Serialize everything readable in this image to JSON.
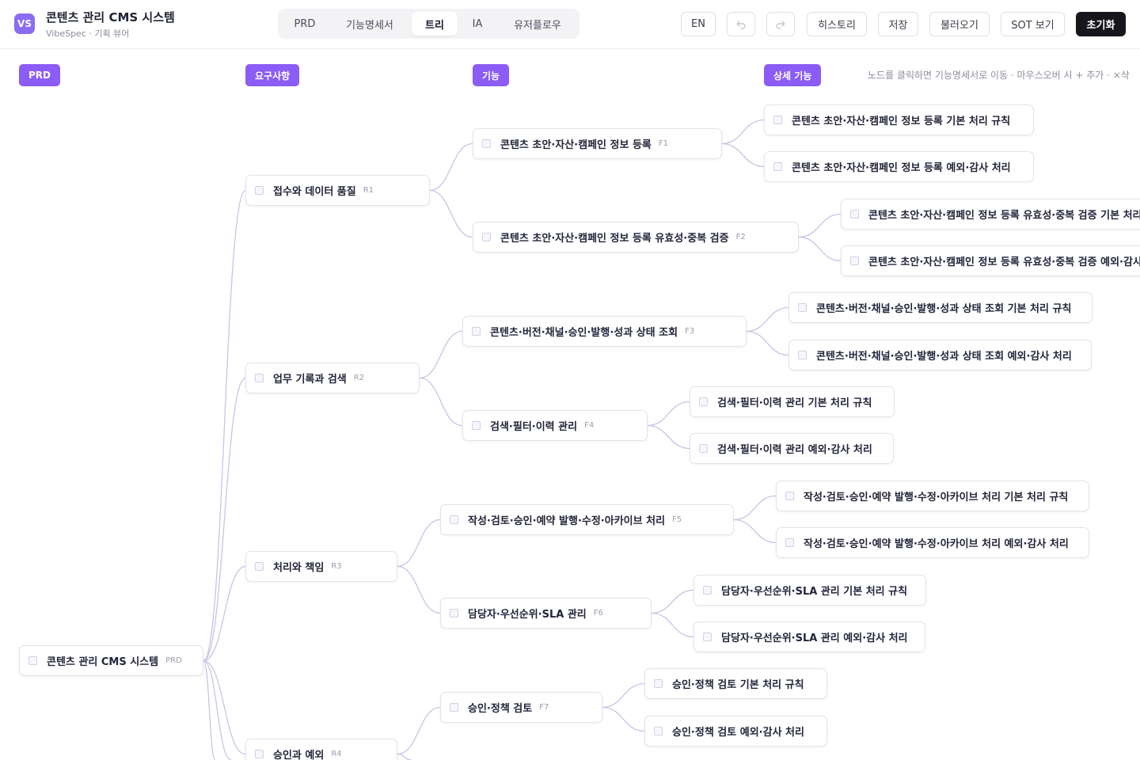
{
  "app": {
    "logo": "VS",
    "title": "콘텐츠 관리 CMS 시스템",
    "subtitle": "VibeSpec · 기획 뷰어"
  },
  "tabs": [
    {
      "label": "PRD"
    },
    {
      "label": "기능명세서"
    },
    {
      "label": "트리",
      "active": true
    },
    {
      "label": "IA"
    },
    {
      "label": "유저플로우"
    }
  ],
  "toolbar": {
    "lang": "EN",
    "undo_icon": "undo-icon",
    "redo_icon": "redo-icon",
    "history": "히스토리",
    "save": "저장",
    "load": "불러오기",
    "sot": "SOT 보기",
    "reset": "초기화"
  },
  "columns": {
    "prd": "PRD",
    "requirements": "요구사항",
    "features": "기능",
    "details": "상세 기능"
  },
  "hint": "노드를 클릭하면 기능명세서로 이동 · 마우스오버 시 + 추가 · ×삭",
  "colors": {
    "accent": "#8b5cf6",
    "edge": "#c9c3e4",
    "dark_button": "#16171c"
  },
  "tree": {
    "root": {
      "label": "콘텐츠 관리 CMS 시스템",
      "code": "PRD"
    },
    "requirements": [
      {
        "label": "접수와 데이터 품질",
        "code": "R1"
      },
      {
        "label": "업무 기록과 검색",
        "code": "R2"
      },
      {
        "label": "처리와 책임",
        "code": "R3"
      },
      {
        "label": "승인과 예외",
        "code": "R4"
      }
    ],
    "features": [
      {
        "label": "콘텐츠 초안·자산·캠페인 정보 등록",
        "code": "F1"
      },
      {
        "label": "콘텐츠 초안·자산·캠페인 정보 등록 유효성·중복 검증",
        "code": "F2"
      },
      {
        "label": "콘텐츠·버전·채널·승인·발행·성과 상태 조회",
        "code": "F3"
      },
      {
        "label": "검색·필터·이력 관리",
        "code": "F4"
      },
      {
        "label": "작성·검토·승인·예약 발행·수정·아카이브 처리",
        "code": "F5"
      },
      {
        "label": "담당자·우선순위·SLA 관리",
        "code": "F6"
      },
      {
        "label": "승인·정책 검토",
        "code": "F7"
      }
    ],
    "details": [
      {
        "label": "콘텐츠 초안·자산·캠페인 정보 등록 기본 처리 규칙"
      },
      {
        "label": "콘텐츠 초안·자산·캠페인 정보 등록 예외·감사 처리"
      },
      {
        "label": "콘텐츠 초안·자산·캠페인 정보 등록 유효성·중복 검증 기본 처리"
      },
      {
        "label": "콘텐츠 초안·자산·캠페인 정보 등록 유효성·중복 검증 예외·감사"
      },
      {
        "label": "콘텐츠·버전·채널·승인·발행·성과 상태 조회 기본 처리 규칙"
      },
      {
        "label": "콘텐츠·버전·채널·승인·발행·성과 상태 조회 예외·감사 처리"
      },
      {
        "label": "검색·필터·이력 관리 기본 처리 규칙"
      },
      {
        "label": "검색·필터·이력 관리 예외·감사 처리"
      },
      {
        "label": "작성·검토·승인·예약 발행·수정·아카이브 처리 기본 처리 규칙"
      },
      {
        "label": "작성·검토·승인·예약 발행·수정·아카이브 처리 예외·감사 처리"
      },
      {
        "label": "담당자·우선순위·SLA 관리 기본 처리 규칙"
      },
      {
        "label": "담당자·우선순위·SLA 관리 예외·감사 처리"
      },
      {
        "label": "승인·정책 검토 기본 처리 규칙"
      },
      {
        "label": "승인·정책 검토 예외·감사 처리"
      }
    ]
  }
}
